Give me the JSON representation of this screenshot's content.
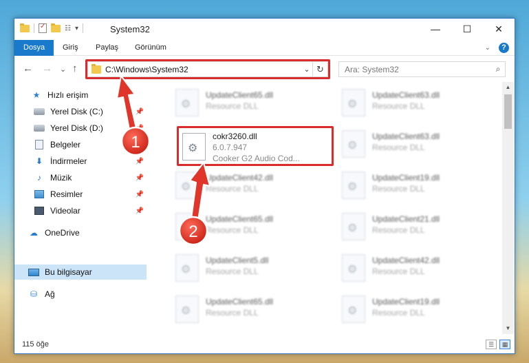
{
  "window": {
    "title": "System32",
    "controls": {
      "minimize": "—",
      "maximize": "☐",
      "close": "✕"
    }
  },
  "quick_access_toolbar": {
    "customize": "▾"
  },
  "ribbon": {
    "tabs": [
      {
        "label": "Dosya",
        "active": true
      },
      {
        "label": "Giriş",
        "active": false
      },
      {
        "label": "Paylaş",
        "active": false
      },
      {
        "label": "Görünüm",
        "active": false
      }
    ],
    "collapse": "⌄",
    "help": "?"
  },
  "nav": {
    "back": "←",
    "forward": "→",
    "recent": "⌄",
    "up": "↑",
    "address": "C:\\Windows\\System32",
    "address_dropdown": "⌄",
    "refresh": "↻",
    "search_placeholder": "Ara: System32",
    "search_icon": "⌕"
  },
  "sidebar": {
    "items": [
      {
        "label": "Hızlı erişim",
        "icon": "star-icon",
        "pinned": false
      },
      {
        "label": "Yerel Disk (C:)",
        "icon": "drive-icon",
        "pinned": true
      },
      {
        "label": "Yerel Disk (D:)",
        "icon": "drive-icon",
        "pinned": true
      },
      {
        "label": "Belgeler",
        "icon": "documents-icon",
        "pinned": true
      },
      {
        "label": "İndirmeler",
        "icon": "downloads-icon",
        "pinned": true
      },
      {
        "label": "Müzik",
        "icon": "music-icon",
        "pinned": true
      },
      {
        "label": "Resimler",
        "icon": "pictures-icon",
        "pinned": true
      },
      {
        "label": "Videolar",
        "icon": "videos-icon",
        "pinned": true
      },
      {
        "label": "OneDrive",
        "icon": "cloud-icon",
        "pinned": false
      },
      {
        "label": "Bu bilgisayar",
        "icon": "computer-icon",
        "pinned": false,
        "selected": true
      },
      {
        "label": "Ağ",
        "icon": "network-icon",
        "pinned": false
      }
    ],
    "pin_glyph": "📌"
  },
  "files": {
    "left_column": [
      {
        "name": "UpdateClient65.dll",
        "desc": "Resource DLL"
      },
      {
        "name": "cokr3260.dll",
        "version": "6.0.7.947",
        "desc": "Cooker G2 Audio Cod...",
        "highlighted": true
      },
      {
        "name": "UpdateClient42.dll",
        "desc": "Resource DLL"
      },
      {
        "name": "UpdateClient65.dll",
        "desc": "Resource DLL"
      },
      {
        "name": "UpdateClient5.dll",
        "desc": "Resource DLL"
      },
      {
        "name": "UpdateClient65.dll",
        "desc": "Resource DLL"
      }
    ],
    "right_column": [
      {
        "name": "UpdateClient63.dll",
        "desc": "Resource DLL"
      },
      {
        "name": "UpdateClient63.dll",
        "desc": "Resource DLL"
      },
      {
        "name": "UpdateClient19.dll",
        "desc": "Resource DLL"
      },
      {
        "name": "UpdateClient21.dll",
        "desc": "Resource DLL"
      },
      {
        "name": "UpdateClient42.dll",
        "desc": "Resource DLL"
      },
      {
        "name": "UpdateClient19.dll",
        "desc": "Resource DLL"
      }
    ]
  },
  "status": {
    "item_count": "115 öğe"
  },
  "annotations": {
    "step1": "1",
    "step2": "2",
    "highlight_color": "#d92c2c"
  }
}
